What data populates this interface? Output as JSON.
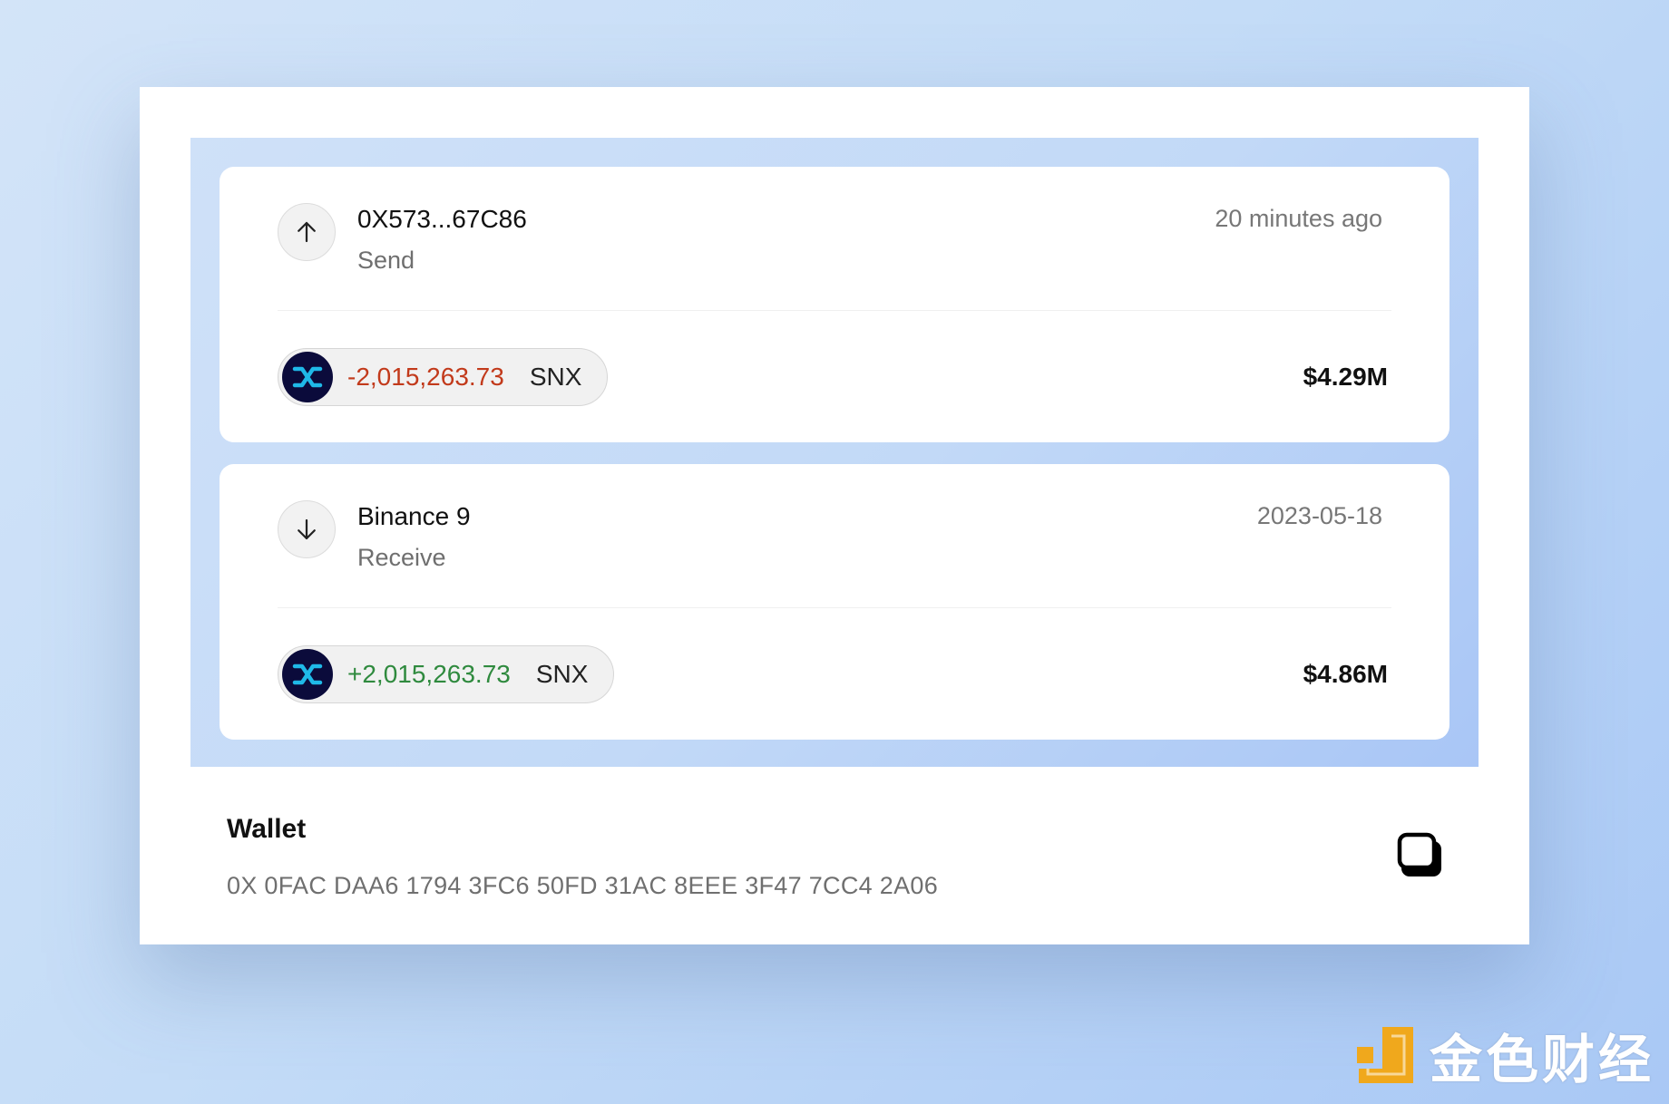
{
  "transactions": [
    {
      "direction": "send",
      "direction_icon": "arrow-up-icon",
      "counterparty": "0X573...67C86",
      "type": "Send",
      "time": "20 minutes ago",
      "amount": "-2,015,263.73",
      "token": "SNX",
      "usd_value": "$4.29M"
    },
    {
      "direction": "receive",
      "direction_icon": "arrow-down-icon",
      "counterparty": "Binance 9",
      "type": "Receive",
      "time": "2023-05-18",
      "amount": "+2,015,263.73",
      "token": "SNX",
      "usd_value": "$4.86M"
    }
  ],
  "wallet": {
    "title": "Wallet",
    "address": "0X 0FAC DAA6 1794 3FC6 50FD 31AC 8EEE 3F47 7CC4 2A06",
    "copy_icon": "copy-icon"
  },
  "watermark": {
    "text": "金色财经",
    "logo_icon": "jinse-logo-icon"
  },
  "colors": {
    "negative": "#c23a1b",
    "positive": "#2f8a3e",
    "token_bg": "#0b0b3b",
    "token_mark": "#1fb9e8",
    "watermark_accent": "#f0a81c"
  }
}
